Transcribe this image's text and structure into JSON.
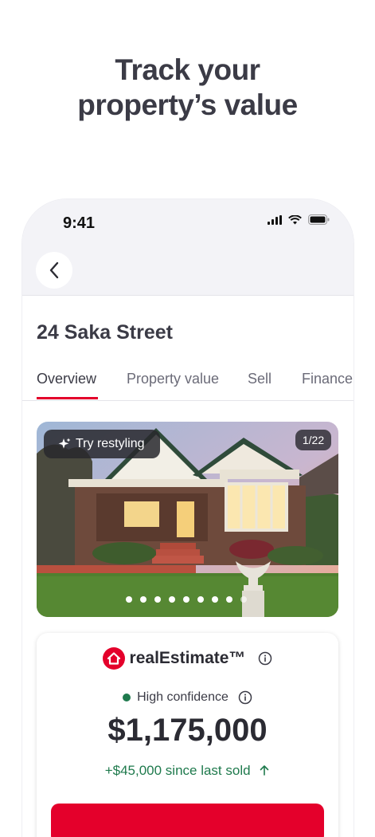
{
  "headline": {
    "line1": "Track your",
    "line2": "property’s value"
  },
  "status_bar": {
    "time": "9:41"
  },
  "listing": {
    "address": "24 Saka Street"
  },
  "tabs": [
    {
      "label": "Overview",
      "active": true
    },
    {
      "label": "Property value",
      "active": false
    },
    {
      "label": "Sell",
      "active": false
    },
    {
      "label": "Finance",
      "active": false
    }
  ],
  "photo": {
    "restyle_label": "Try restyling",
    "counter": "1/22",
    "dot_count": 9,
    "active_dot": 1
  },
  "valuation": {
    "brand": "realEstimate™",
    "confidence": "High confidence",
    "price": "$1,175,000",
    "since_sold": "+$45,000 since last sold"
  },
  "colors": {
    "accent": "#e4002b",
    "positive": "#1f7a4d",
    "text": "#3b3b46",
    "header_bg": "#f3f3f7"
  }
}
